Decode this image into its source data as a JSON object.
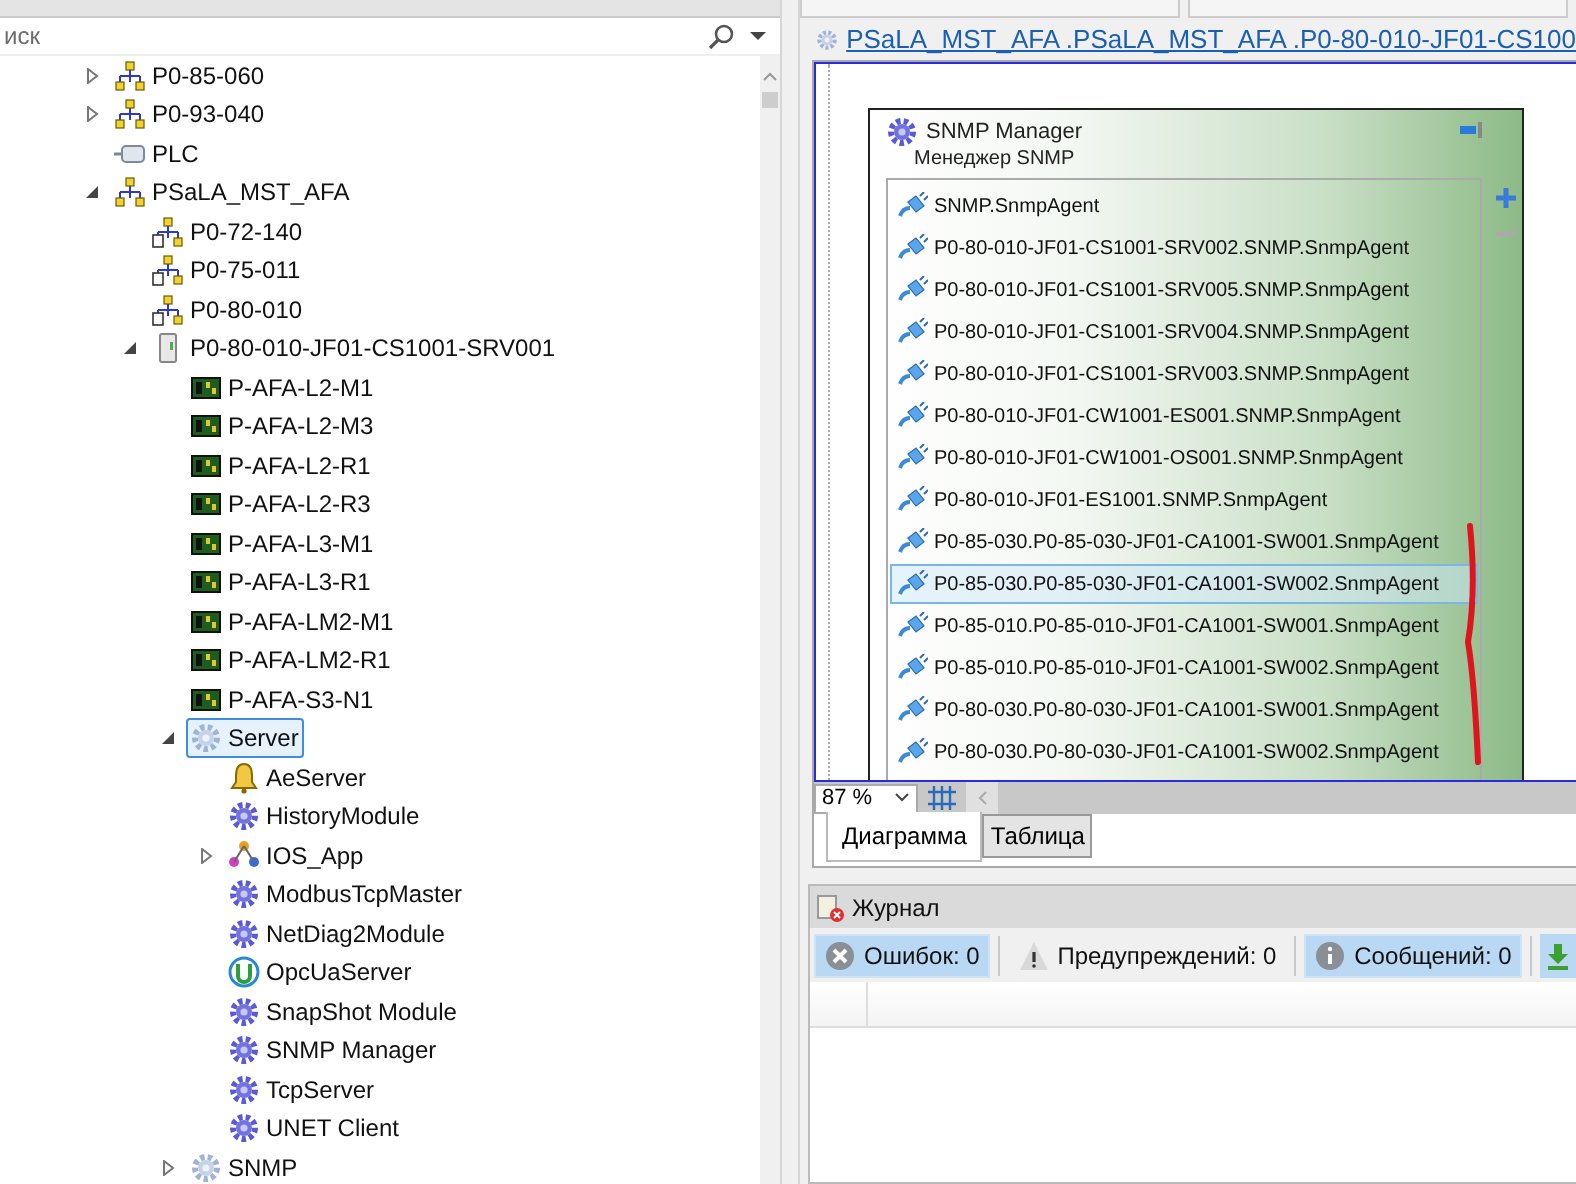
{
  "search": {
    "placeholder": "иск"
  },
  "tree": [
    {
      "label": "P0-85-060",
      "kind": "network",
      "expanded": false,
      "selected": false
    },
    {
      "label": "P0-93-040",
      "kind": "network",
      "expanded": false,
      "selected": false
    },
    {
      "label": "PLC",
      "kind": "plc",
      "selected": false
    },
    {
      "label": "PSaLA_MST_AFA",
      "kind": "network",
      "expanded": true,
      "selected": false,
      "children": [
        {
          "label": "P0-72-140",
          "kind": "network-link",
          "selected": false
        },
        {
          "label": "P0-75-011",
          "kind": "network-link",
          "selected": false
        },
        {
          "label": "P0-80-010",
          "kind": "network-link",
          "selected": false
        },
        {
          "label": "P0-80-010-JF01-CS1001-SRV001",
          "kind": "server",
          "expanded": true,
          "selected": false,
          "children": [
            {
              "label": "P-AFA-L2-M1",
              "kind": "board",
              "selected": false
            },
            {
              "label": "P-AFA-L2-M3",
              "kind": "board",
              "selected": false
            },
            {
              "label": "P-AFA-L2-R1",
              "kind": "board",
              "selected": false
            },
            {
              "label": "P-AFA-L2-R3",
              "kind": "board",
              "selected": false
            },
            {
              "label": "P-AFA-L3-M1",
              "kind": "board",
              "selected": false
            },
            {
              "label": "P-AFA-L3-R1",
              "kind": "board",
              "selected": false
            },
            {
              "label": "P-AFA-LM2-M1",
              "kind": "board",
              "selected": false
            },
            {
              "label": "P-AFA-LM2-R1",
              "kind": "board",
              "selected": false
            },
            {
              "label": "P-AFA-S3-N1",
              "kind": "board",
              "selected": false
            },
            {
              "label": "Server",
              "kind": "service-group",
              "expanded": true,
              "selected": true,
              "children": [
                {
                  "label": "AeServer",
                  "kind": "alarm",
                  "selected": false
                },
                {
                  "label": "HistoryModule",
                  "kind": "module",
                  "selected": false
                },
                {
                  "label": "IOS_App",
                  "kind": "app",
                  "expanded": false,
                  "selected": false
                },
                {
                  "label": "ModbusTcpMaster",
                  "kind": "module",
                  "selected": false
                },
                {
                  "label": "NetDiag2Module",
                  "kind": "module",
                  "selected": false
                },
                {
                  "label": "OpcUaServer",
                  "kind": "opcua",
                  "selected": false
                },
                {
                  "label": "SnapShot Module",
                  "kind": "module",
                  "selected": false
                },
                {
                  "label": "SNMP Manager",
                  "kind": "module",
                  "selected": false
                },
                {
                  "label": "TcpServer",
                  "kind": "module",
                  "selected": false
                },
                {
                  "label": "UNET Client",
                  "kind": "module",
                  "selected": false
                }
              ]
            },
            {
              "label": "SNMP",
              "kind": "service-group",
              "expanded": false,
              "selected": false
            }
          ]
        }
      ]
    }
  ],
  "document": {
    "breadcrumb": "PSaLA_MST_AFA .PSaLA_MST_AFA .P0-80-010-JF01-CS100",
    "node": {
      "title": "SNMP Manager",
      "subtitle": "Менеджер SNMP",
      "agents": [
        {
          "label": "SNMP.SnmpAgent",
          "selected": false
        },
        {
          "label": "P0-80-010-JF01-CS1001-SRV002.SNMP.SnmpAgent",
          "selected": false
        },
        {
          "label": "P0-80-010-JF01-CS1001-SRV005.SNMP.SnmpAgent",
          "selected": false
        },
        {
          "label": "P0-80-010-JF01-CS1001-SRV004.SNMP.SnmpAgent",
          "selected": false
        },
        {
          "label": "P0-80-010-JF01-CS1001-SRV003.SNMP.SnmpAgent",
          "selected": false
        },
        {
          "label": "P0-80-010-JF01-CW1001-ES001.SNMP.SnmpAgent",
          "selected": false
        },
        {
          "label": "P0-80-010-JF01-CW1001-OS001.SNMP.SnmpAgent",
          "selected": false
        },
        {
          "label": "P0-80-010-JF01-ES1001.SNMP.SnmpAgent",
          "selected": false
        },
        {
          "label": "P0-85-030.P0-85-030-JF01-CA1001-SW001.SnmpAgent",
          "selected": false
        },
        {
          "label": "P0-85-030.P0-85-030-JF01-CA1001-SW002.SnmpAgent",
          "selected": true
        },
        {
          "label": "P0-85-010.P0-85-010-JF01-CA1001-SW001.SnmpAgent",
          "selected": false
        },
        {
          "label": "P0-85-010.P0-85-010-JF01-CA1001-SW002.SnmpAgent",
          "selected": false
        },
        {
          "label": "P0-80-030.P0-80-030-JF01-CA1001-SW001.SnmpAgent",
          "selected": false
        },
        {
          "label": "P0-80-030.P0-80-030-JF01-CA1001-SW002.SnmpAgent",
          "selected": false
        }
      ]
    },
    "zoom": "87 %",
    "view_tabs": [
      {
        "label": "Диаграмма",
        "selected": true
      },
      {
        "label": "Таблица",
        "selected": false
      }
    ]
  },
  "journal": {
    "title": "Журнал",
    "filters": [
      {
        "kind": "error",
        "label": "Ошибок: 0",
        "selected": true
      },
      {
        "kind": "warning",
        "label": "Предупреждений: 0",
        "selected": false
      },
      {
        "kind": "info",
        "label": "Сообщений: 0",
        "selected": true
      }
    ]
  }
}
